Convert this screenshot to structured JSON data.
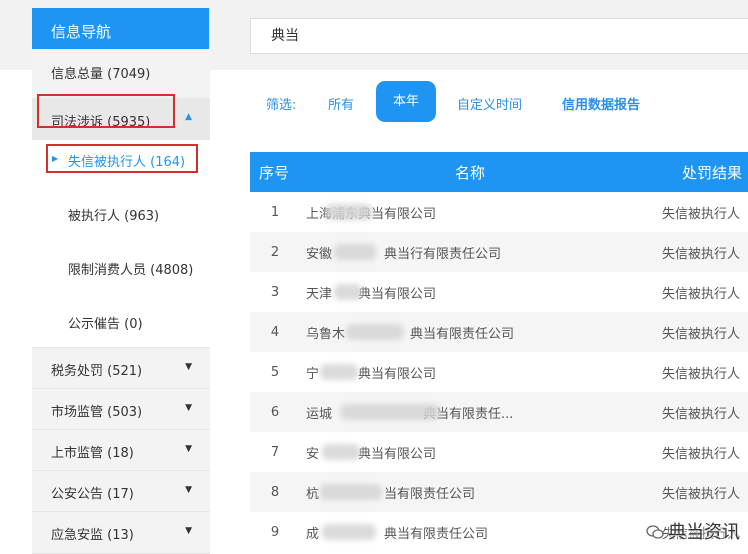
{
  "search": {
    "value": "典当"
  },
  "sidebar": {
    "title": "信息导航",
    "items": [
      {
        "label": "信息总量 (7049)"
      },
      {
        "label": "司法涉诉 (5935)"
      },
      {
        "label": "失信被执行人 (164)"
      },
      {
        "label": "被执行人 (963)"
      },
      {
        "label": "限制消费人员 (4808)"
      },
      {
        "label": "公示催告 (0)"
      },
      {
        "label": "税务处罚 (521)"
      },
      {
        "label": "市场监管 (503)"
      },
      {
        "label": "上市监管 (18)"
      },
      {
        "label": "公安公告 (17)"
      },
      {
        "label": "应急安监 (13)"
      }
    ]
  },
  "filters": {
    "label": "筛选:",
    "options": [
      "所有",
      "本年",
      "自定义时间",
      "信用数据报告"
    ],
    "active": "本年"
  },
  "table": {
    "headers": [
      "序号",
      "名称",
      "处罚结果"
    ],
    "rows": [
      {
        "idx": "1",
        "name": "上海浦东典当有限公司",
        "result": "失信被执行人"
      },
      {
        "idx": "2",
        "name": "安徽　　　　典当行有限责任公司",
        "result": "失信被执行人"
      },
      {
        "idx": "3",
        "name": "天津　　典当有限公司",
        "result": "失信被执行人"
      },
      {
        "idx": "4",
        "name": "乌鲁木　　　　　典当有限责任公司",
        "result": "失信被执行人"
      },
      {
        "idx": "5",
        "name": "宁　　　典当有限公司",
        "result": "失信被执行人"
      },
      {
        "idx": "6",
        "name": "运城　　　　　　　典当有限责任...",
        "result": "失信被执行人"
      },
      {
        "idx": "7",
        "name": "安　　　典当有限公司",
        "result": "失信被执行人"
      },
      {
        "idx": "8",
        "name": "杭　　　　　当有限责任公司",
        "result": "失信被执行人"
      },
      {
        "idx": "9",
        "name": "成　　　　　典当有限责任公司",
        "result": "失信被执行人"
      }
    ]
  },
  "watermark": {
    "text": "典当资讯"
  },
  "colors": {
    "accent": "#1e95f2",
    "highlight_border": "#d32f2f"
  }
}
